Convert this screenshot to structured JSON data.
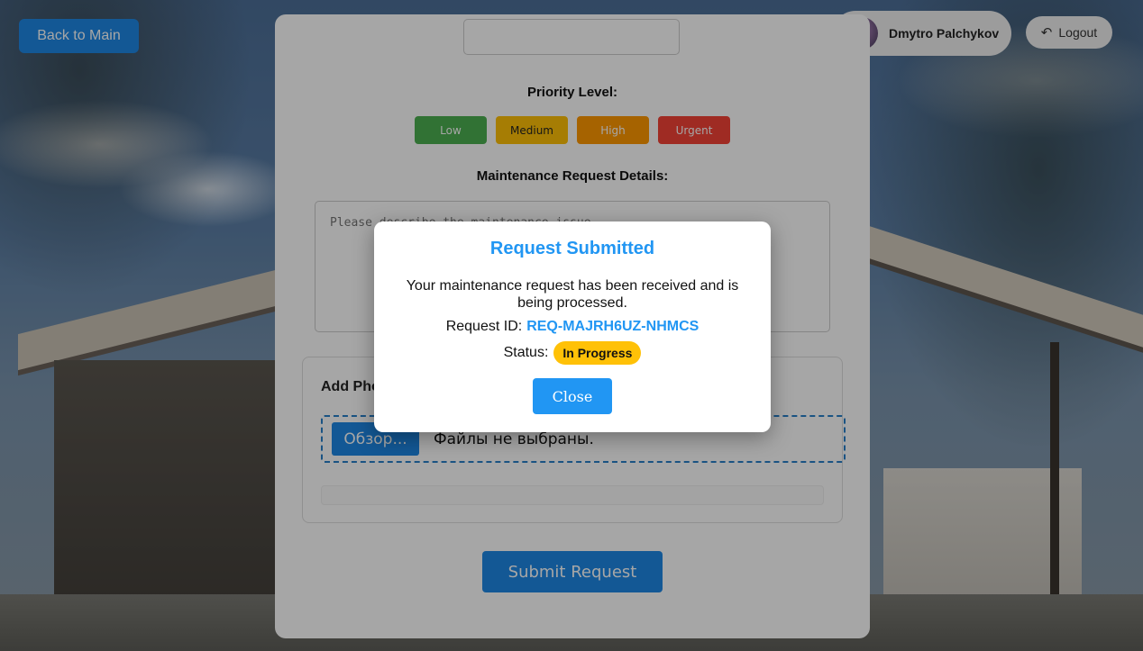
{
  "nav": {
    "back_label": "Back to Main"
  },
  "user": {
    "name": "Dmytro Palchykov",
    "logout_label": "Logout"
  },
  "form": {
    "priority_label": "Priority Level:",
    "priorities": [
      "Low",
      "Medium",
      "High",
      "Urgent"
    ],
    "details_label": "Maintenance Request Details:",
    "details_placeholder": "Please describe the maintenance issue...",
    "photos_title": "Add Photos",
    "browse_label": "Обзор...",
    "file_status": "Файлы не выбраны.",
    "submit_label": "Submit Request"
  },
  "modal": {
    "title": "Request Submitted",
    "message": "Your maintenance request has been received and is being processed.",
    "request_id_label": "Request ID:",
    "request_id": "REQ-MAJRH6UZ-NHMCS",
    "status_label": "Status:",
    "status": "In Progress",
    "close_label": "Close"
  },
  "colors": {
    "primary": "#1e88e5",
    "accent": "#2196f3",
    "low": "#4caf50",
    "medium": "#ffc107",
    "high": "#ff9800",
    "urgent": "#f44336",
    "status_badge": "#ffc107"
  },
  "icons": {
    "logout": "logout-arrow-icon",
    "avatar": "user-avatar"
  }
}
